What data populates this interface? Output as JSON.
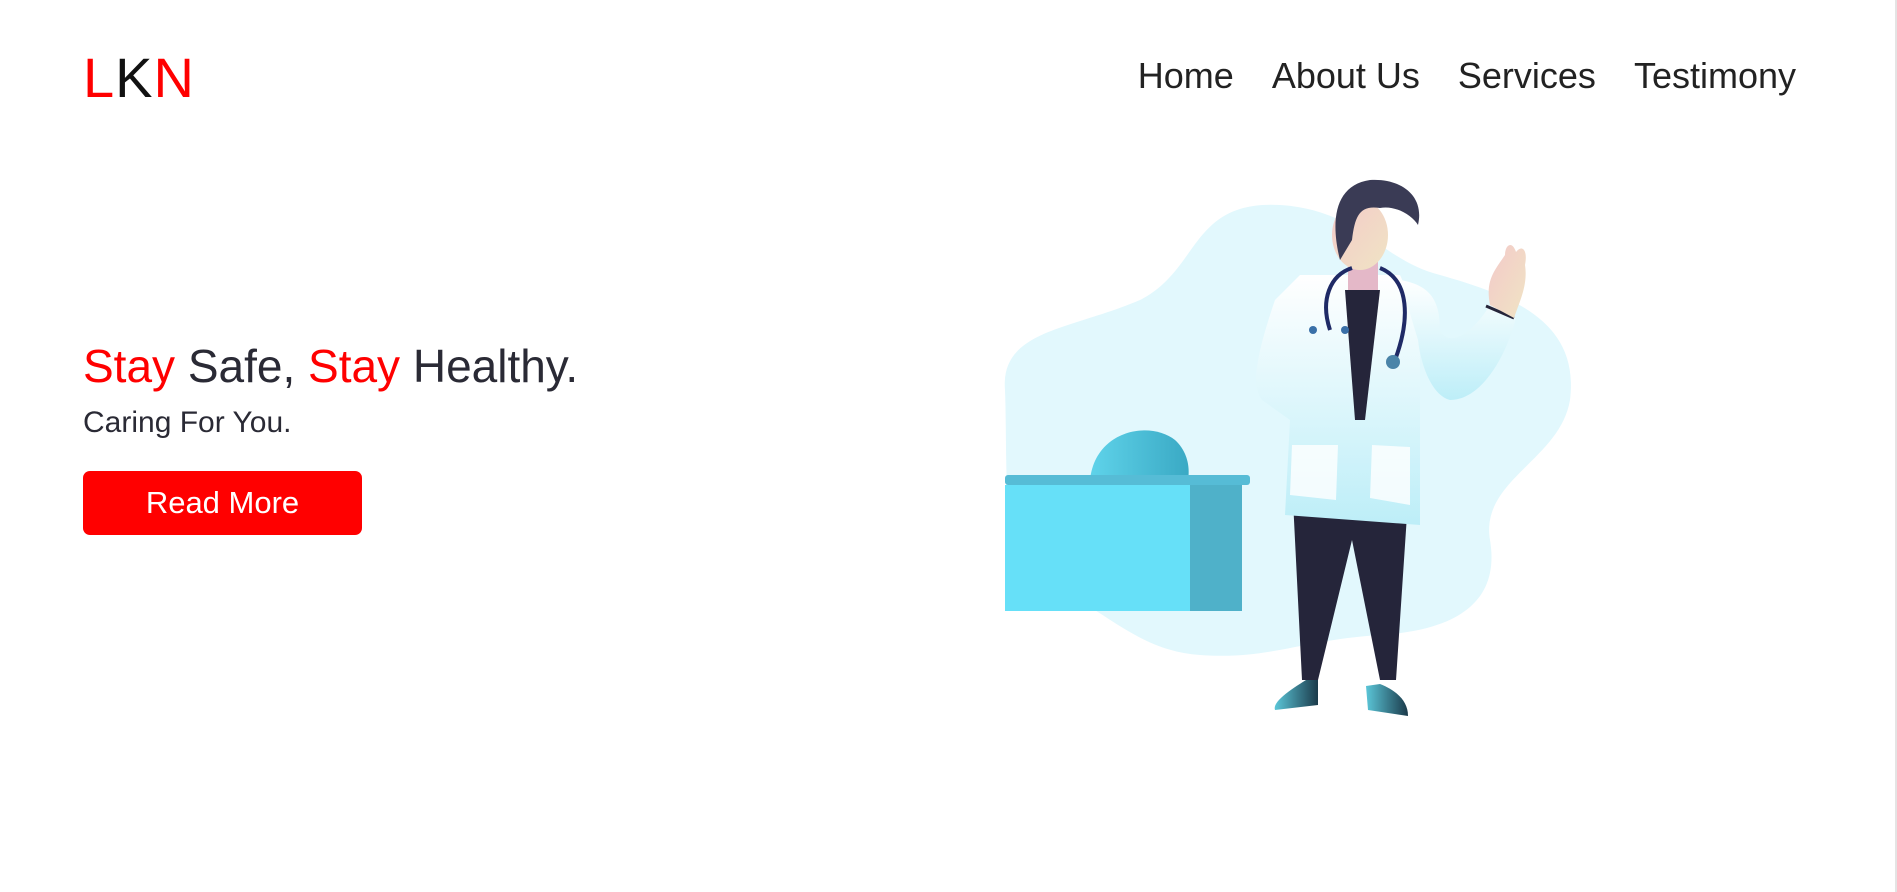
{
  "brand": {
    "letters": [
      "L",
      "K",
      "N"
    ]
  },
  "nav": {
    "items": [
      {
        "label": "Home"
      },
      {
        "label": "About Us"
      },
      {
        "label": "Services"
      },
      {
        "label": "Testimony"
      }
    ]
  },
  "hero": {
    "title": {
      "word1": "Stay",
      "part2": " Safe, ",
      "word3": "Stay",
      "part4": " Healthy."
    },
    "subtitle": "Caring For You.",
    "button_label": "Read More"
  },
  "colors": {
    "accent": "#ff0000",
    "text_dark": "#2a2a35",
    "illustration_blob": "#e2f8fd",
    "illustration_desk": "#66e0f8"
  },
  "illustration": {
    "icon": "doctor-illustration"
  }
}
